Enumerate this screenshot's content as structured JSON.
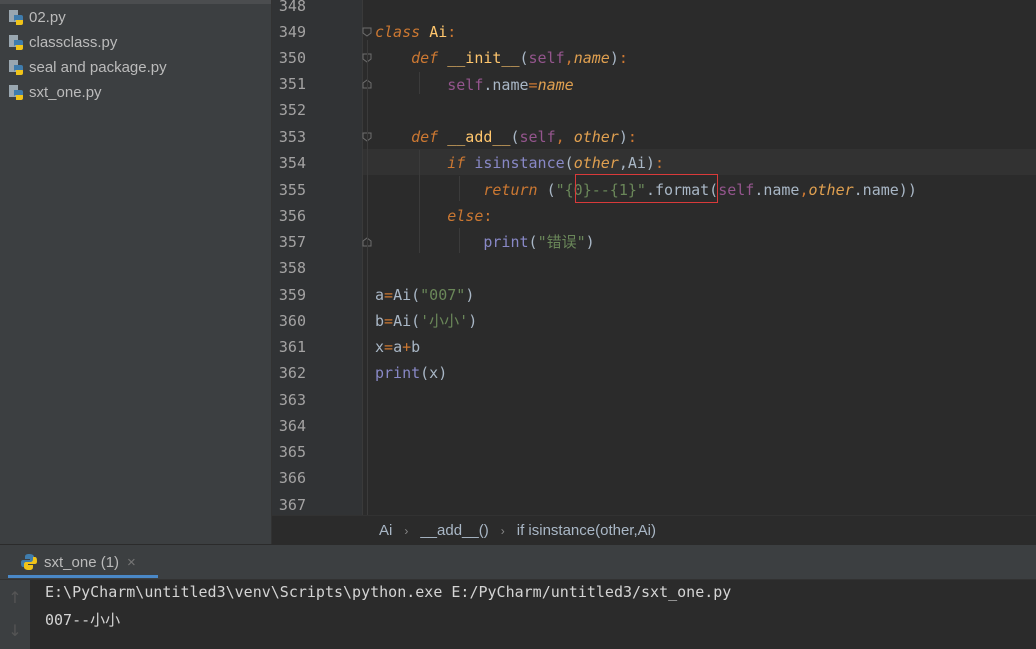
{
  "project_files": [
    "02.py",
    "classclass.py",
    "seal and package.py",
    "sxt_one.py"
  ],
  "editor": {
    "line_numbers": [
      "348",
      "349",
      "350",
      "351",
      "352",
      "353",
      "354",
      "355",
      "356",
      "357",
      "358",
      "359",
      "360",
      "361",
      "362",
      "363",
      "364",
      "365",
      "366",
      "367"
    ],
    "code": {
      "l349": {
        "kw": "class",
        "name": "Ai",
        "colon": ":"
      },
      "l350": {
        "kw": "def",
        "name": "__init__",
        "open": "(",
        "self": "self",
        "comma": ",",
        "param": "name",
        "close": ")",
        "colon": ":"
      },
      "l351": {
        "self": "self",
        "attr": ".name",
        "eq": "=",
        "param": "name"
      },
      "l353": {
        "kw": "def",
        "name": "__add__",
        "open": "(",
        "self": "self",
        "comma": ", ",
        "param": "other",
        "close": ")",
        "colon": ":"
      },
      "l354": {
        "kw": "if",
        "builtin": "isinstance",
        "open": "(",
        "param": "other",
        "rest": ",Ai)",
        "colon": ":"
      },
      "l355": {
        "kw": "return",
        "open": " (",
        "str": "\"{0}--{1}\"",
        "dot_format": ".format(",
        "self": "self",
        "attr1": ".name",
        "comma": ",",
        "param": "other",
        "attr2": ".name))"
      },
      "l356": {
        "kw": "else",
        "colon": ":"
      },
      "l357": {
        "builtin": "print",
        "open": "(",
        "str": "\"错误\"",
        "close": ")"
      },
      "l359": {
        "var": "a",
        "eq": "=",
        "cls": "Ai",
        "open": "(",
        "str": "\"007\"",
        "close": ")"
      },
      "l360": {
        "var": "b",
        "eq": "=",
        "cls": "Ai",
        "open": "(",
        "str": "'小小'",
        "close": ")"
      },
      "l361": {
        "var": "x",
        "eq": "=",
        "a": "a",
        "plus": "+",
        "b": "b"
      },
      "l362": {
        "builtin": "print",
        "rest": "(x)"
      }
    }
  },
  "breadcrumb": [
    "Ai",
    "__add__()",
    "if isinstance(other,Ai)"
  ],
  "run_panel": {
    "tab_label": "sxt_one (1)",
    "close_glyph": "×",
    "console": [
      "E:\\PyCharm\\untitled3\\venv\\Scripts\\python.exe E:/PyCharm/untitled3/sxt_one.py",
      "007--小小"
    ],
    "up_glyph": "↑",
    "down_glyph": "↓"
  },
  "colors": {
    "bg": "#2b2b2b",
    "sidebar": "#3c3f41",
    "keyword": "#cc7832",
    "function": "#ffc66d",
    "self": "#94558d",
    "string": "#6a8759",
    "highlight_box": "#d93a3a",
    "tab_accent": "#4a88c7"
  }
}
